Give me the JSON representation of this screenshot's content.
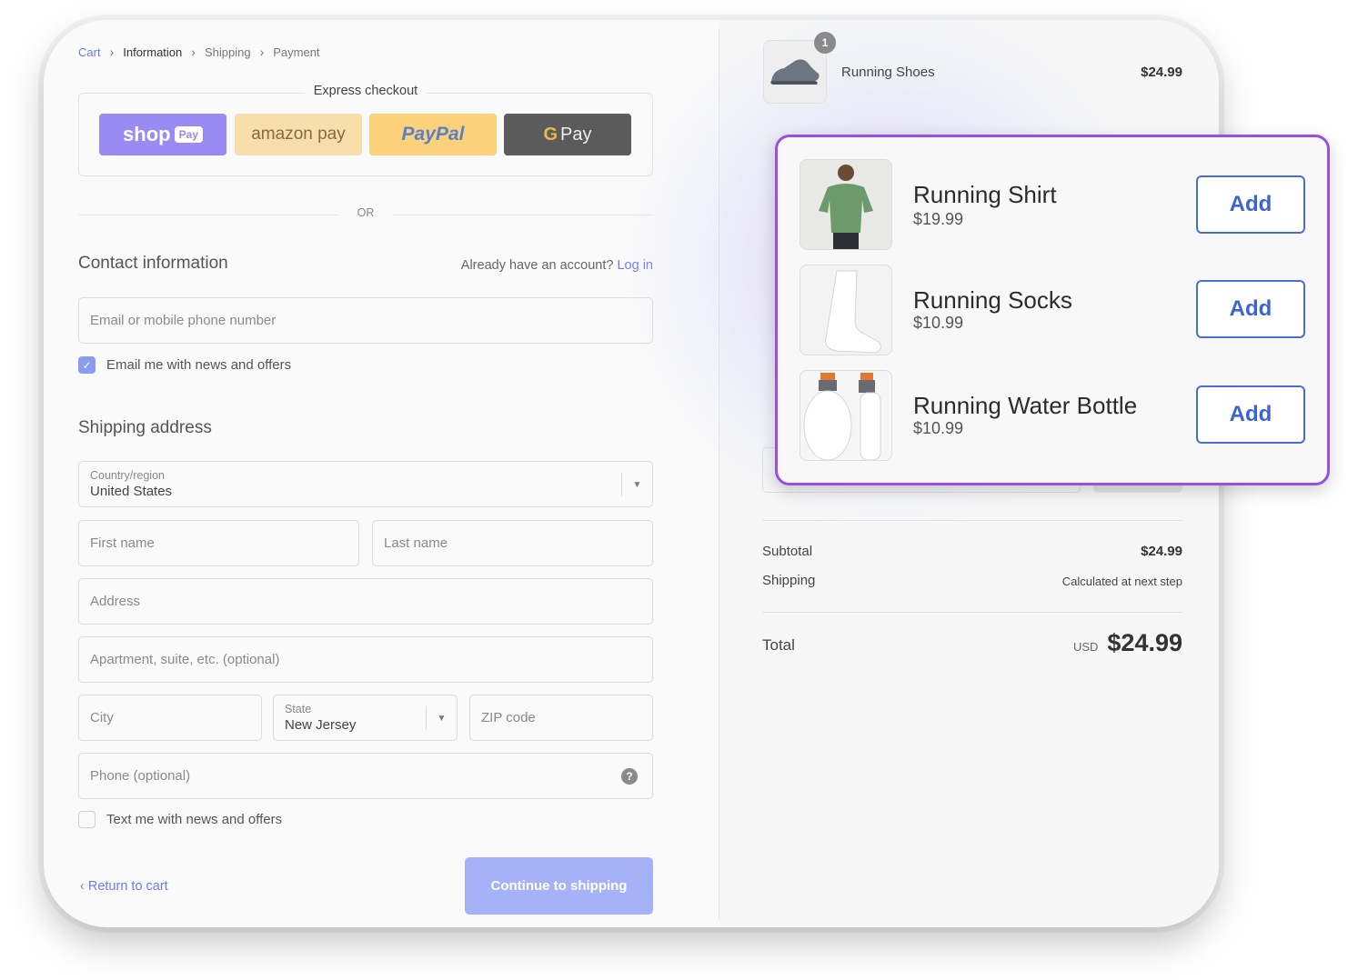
{
  "breadcrumb": {
    "cart": "Cart",
    "information": "Information",
    "shipping": "Shipping",
    "payment": "Payment"
  },
  "express": {
    "title": "Express checkout",
    "shop_pay": "shop",
    "shop_pay_pill": "Pay",
    "amazon_pay": "amazon pay",
    "paypal": "PayPal",
    "gpay_g": "G",
    "gpay": "Pay",
    "or": "OR"
  },
  "contact": {
    "title": "Contact information",
    "login_hint": "Already have an account?",
    "login_link": "Log in",
    "email_placeholder": "Email or mobile phone number",
    "email_opt_in": "Email me with news and offers",
    "email_opt_in_checked": true
  },
  "shipping": {
    "title": "Shipping address",
    "country_label": "Country/region",
    "country_value": "United States",
    "first_name": "First name",
    "last_name": "Last name",
    "address": "Address",
    "apartment": "Apartment, suite, etc. (optional)",
    "city": "City",
    "state_label": "State",
    "state_value": "New Jersey",
    "zip": "ZIP code",
    "phone": "Phone (optional)",
    "text_opt_in": "Text me with news and offers"
  },
  "actions": {
    "return": "Return to cart",
    "continue": "Continue to shipping"
  },
  "summary": {
    "item_name": "Running Shoes",
    "item_price": "$24.99",
    "item_qty": "1",
    "subtotal_label": "Subtotal",
    "subtotal_value": "$24.99",
    "shipping_label": "Shipping",
    "shipping_value": "Calculated at next step",
    "total_label": "Total",
    "currency": "USD",
    "total_value": "$24.99"
  },
  "upsell": {
    "items": [
      {
        "name": "Running Shirt",
        "price": "$19.99",
        "button": "Add"
      },
      {
        "name": "Running Socks",
        "price": "$10.99",
        "button": "Add"
      },
      {
        "name": "Running Water Bottle",
        "price": "$10.99",
        "button": "Add"
      }
    ]
  },
  "colors": {
    "accent": "#6b7cf2",
    "upsell_border": "#9a4fe0",
    "add_button": "#3c62d6"
  }
}
